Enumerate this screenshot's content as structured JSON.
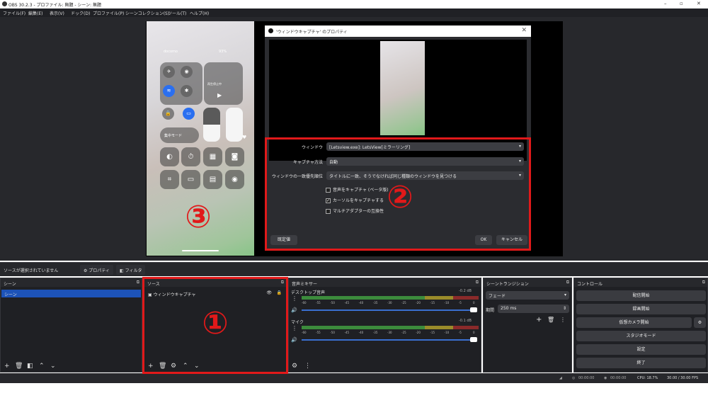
{
  "window": {
    "title": "OBS 30.2.3 - プロファイル: 無題 - シーン: 無題"
  },
  "menu": [
    "ファイル(F)",
    "編集(E)",
    "表示(V)",
    "ドック(D)",
    "プロファイル(P)",
    "シーンコレクション(S)",
    "ツール(T)",
    "ヘルプ(H)"
  ],
  "phone": {
    "carrier": "docomo",
    "battery": "93%",
    "music": "再生停止中",
    "tile_labels": [
      "集中モード"
    ]
  },
  "dialog": {
    "title": "'ウィンドウキャプチャ' のプロパティ",
    "fields": [
      {
        "label": "ウィンドウ",
        "value": "[Letsview.exe]: LetsView[ミラーリング]"
      },
      {
        "label": "キャプチャ方法",
        "value": "自動"
      },
      {
        "label": "ウィンドウの一致優先順位",
        "value": "タイトルに一致、そうでなければ同じ種類のウィンドウを見つける"
      }
    ],
    "checkboxes": [
      {
        "label": "音声をキャプチャ (ベータ版)",
        "checked": false
      },
      {
        "label": "カーソルをキャプチャする",
        "checked": true
      },
      {
        "label": "マルチアダプターの互換性",
        "checked": false
      }
    ],
    "defaults_button": "既定値",
    "ok_button": "OK",
    "cancel_button": "キャンセル"
  },
  "source_bar": {
    "message": "ソースが選択されていません",
    "properties": "プロパティ",
    "filters": "フィルタ"
  },
  "scenes": {
    "title": "シーン",
    "items": [
      "シーン"
    ]
  },
  "sources": {
    "title": "ソース",
    "items": [
      "ウィンドウキャプチャ"
    ]
  },
  "mixer": {
    "title": "音声ミキサー",
    "channels": [
      {
        "name": "デスクトップ音声",
        "db": "-0.2 dB"
      },
      {
        "name": "マイク",
        "db": "-0.1 dB"
      }
    ],
    "ticks": [
      "-60",
      "-55",
      "-50",
      "-45",
      "-40",
      "-35",
      "-30",
      "-25",
      "-20",
      "-15",
      "-10",
      "-5",
      "0"
    ]
  },
  "transitions": {
    "title": "シーントランジション",
    "type": "フェード",
    "duration_label": "期間",
    "duration": "250 ms"
  },
  "controls": {
    "title": "コントロール",
    "buttons": [
      "配信開始",
      "録画開始",
      "仮想カメラ開始",
      "スタジオモード",
      "設定",
      "終了"
    ]
  },
  "status": {
    "stream_time": "00:00:00",
    "rec_time": "00:00:00",
    "cpu": "CPU: 18.7%",
    "fps": "30.00 / 30.00 FPS"
  },
  "annotations": {
    "one": "①",
    "two": "②",
    "three": "③"
  },
  "colors": {
    "accent_red": "#e1191a",
    "selection_blue": "#1d53b8",
    "meter_green": "#3c8b3c",
    "meter_yellow": "#9a8b2a",
    "meter_red": "#8a2a2a"
  }
}
